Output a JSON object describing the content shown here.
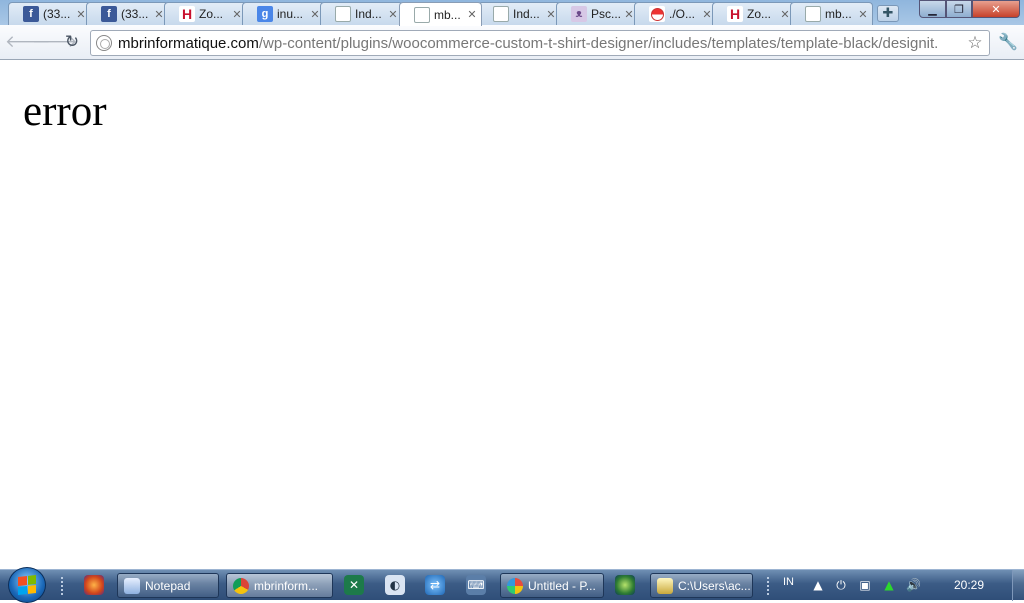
{
  "tabs": [
    {
      "title": "(33...",
      "icon": "facebook-icon"
    },
    {
      "title": "(33...",
      "icon": "facebook-icon"
    },
    {
      "title": "Zo...",
      "icon": "h-logo-icon"
    },
    {
      "title": "inu...",
      "icon": "google-icon"
    },
    {
      "title": "Ind...",
      "icon": "document-icon"
    },
    {
      "title": "mb...",
      "icon": "document-icon",
      "active": true
    },
    {
      "title": "Ind...",
      "icon": "document-icon"
    },
    {
      "title": "Psc...",
      "icon": "cat-icon"
    },
    {
      "title": "./O...",
      "icon": "flag-icon"
    },
    {
      "title": "Zo...",
      "icon": "h-logo-icon"
    },
    {
      "title": "mb...",
      "icon": "document-icon"
    }
  ],
  "address": {
    "host": "mbrinformatique.com",
    "path": "/wp-content/plugins/woocommerce-custom-t-shirt-designer/includes/templates/template-black/designit."
  },
  "page": {
    "text": "error"
  },
  "taskbar": {
    "buttons": [
      {
        "label": "Notepad",
        "icon": "notepad-icon"
      },
      {
        "label": "mbrinform...",
        "icon": "chrome-icon",
        "active": true
      },
      {
        "label": "Untitled - P...",
        "icon": "paint-icon"
      },
      {
        "label": "C:\\Users\\ac...",
        "icon": "notepad-icon"
      }
    ],
    "language": "IN",
    "clock": "20:29"
  },
  "colors": {
    "tab_strip": "#8fb6dd",
    "taskbar": "#3c5c86",
    "facebook": "#3b5998"
  }
}
